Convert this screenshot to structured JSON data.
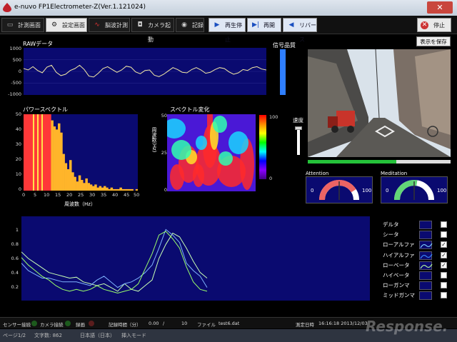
{
  "window": {
    "title": "e-nuvo FP1Electrometer-Z(Ver.1.121024)"
  },
  "toolbar": {
    "buttons": [
      {
        "label": "計測画面"
      },
      {
        "label": "設定画面"
      },
      {
        "label": "脳波計測"
      },
      {
        "label": "カメラ起動"
      },
      {
        "label": "記録"
      },
      {
        "label": "再生停止"
      },
      {
        "label": "再開"
      },
      {
        "label": "リバース"
      },
      {
        "label": "停止"
      }
    ]
  },
  "raw": {
    "label": "RAWデータ",
    "yticks": [
      "1000",
      "500",
      "0",
      "-500",
      "-1000"
    ]
  },
  "signal_quality": {
    "label": "信号品質",
    "level": 1.0
  },
  "save_button": {
    "label": "表示を保存"
  },
  "power_spectrum": {
    "label": "パワースペクトル",
    "yticks": [
      "50",
      "40",
      "30",
      "20",
      "10",
      "0"
    ],
    "xticks": [
      "0",
      "5",
      "10",
      "15",
      "20",
      "25",
      "30",
      "35",
      "40",
      "45",
      "50"
    ],
    "xlabel": "周波数（Hz）"
  },
  "spectrogram": {
    "label": "スペクトル変化",
    "ylabel": "周波数(Hz)",
    "yticks": [
      "50",
      "25",
      "0"
    ],
    "colorbar_ticks": [
      "100",
      "0"
    ]
  },
  "speed": {
    "label": "速度"
  },
  "camera": {
    "progress": 0.62
  },
  "attention": {
    "label": "Attention",
    "min": "0",
    "max": "100",
    "value": 0.82
  },
  "meditation": {
    "label": "Meditation",
    "min": "0",
    "max": "100",
    "value": 0.55
  },
  "trend": {
    "yticks": [
      "1",
      "0.8",
      "0.6",
      "0.4",
      "0.2"
    ]
  },
  "legend": [
    {
      "label": "デルタ",
      "checked": false,
      "color": "#0a0a70"
    },
    {
      "label": "シータ",
      "checked": false,
      "color": "#0a0a70"
    },
    {
      "label": "ローアルファ",
      "checked": true,
      "color": "#7fd1ff"
    },
    {
      "label": "ハイアルファ",
      "checked": true,
      "color": "#3a8cff"
    },
    {
      "label": "ローベータ",
      "checked": true,
      "color": "#b9ff9a"
    },
    {
      "label": "ハイベータ",
      "checked": false,
      "color": "#0a0a70"
    },
    {
      "label": "ローガンマ",
      "checked": false,
      "color": "#0a0a70"
    },
    {
      "label": "ミッドガンマ",
      "checked": false,
      "color": "#0a0a70"
    }
  ],
  "status": {
    "sensor": "センサー接続",
    "camera": "カメラ接続",
    "recording": "録画",
    "rec_time_label": "記録時間（分）",
    "rec_time_value": "0.00",
    "rec_time_sep": "/",
    "rec_time_total": "10",
    "file_label": "ファイル",
    "file_name": "test6.dat",
    "datetime_label": "測定日時",
    "datetime_value": "16:16:18  2013/12/03"
  },
  "taskbar": {
    "items": [
      "ページ1/2",
      "文字数: 862",
      "日本語（日本）",
      "挿入モード"
    ]
  },
  "watermark": "Response.",
  "chart_data": [
    {
      "type": "line",
      "title": "RAWデータ",
      "ylim": [
        -1000,
        1000
      ],
      "series": [
        {
          "values": [
            120,
            60,
            200,
            40,
            -60,
            180,
            260,
            -40,
            -180,
            -120,
            40,
            120,
            260,
            80,
            -200,
            -240,
            -80,
            120,
            200,
            80,
            -40,
            60,
            220,
            180,
            -20,
            -100,
            40,
            60,
            -160,
            -220,
            -120,
            20,
            160,
            80,
            -40,
            -60,
            80,
            160,
            60,
            -80,
            -40,
            80,
            160,
            120,
            -20,
            -120,
            -60,
            80,
            40,
            160,
            200,
            100,
            60
          ]
        }
      ]
    },
    {
      "type": "bar",
      "title": "パワースペクトル",
      "xlabel": "周波数（Hz）",
      "xlim": [
        0,
        50
      ],
      "ylim": [
        0,
        50
      ],
      "values": [
        50,
        50,
        50,
        50,
        50,
        50,
        50,
        50,
        50,
        50,
        50,
        50,
        46,
        42,
        40,
        44,
        38,
        24,
        18,
        14,
        20,
        12,
        9,
        6,
        10,
        7,
        5,
        8,
        5,
        4,
        3,
        4,
        2,
        3,
        2,
        3,
        2,
        1,
        2,
        1,
        1,
        1,
        2,
        1,
        1,
        1,
        1,
        1,
        0,
        1
      ]
    },
    {
      "type": "line",
      "ylim": [
        0.1,
        1
      ],
      "series": [
        {
          "values": [
            0.62,
            0.55,
            0.5,
            0.45,
            0.4,
            0.38,
            0.36,
            0.34,
            0.35,
            0.3,
            0.28,
            0.26,
            0.28,
            0.24,
            0.2,
            0.28,
            0.22,
            0.2,
            0.26,
            0.32,
            0.55,
            0.7,
            0.82,
            0.78,
            0.66,
            0.52,
            0.4,
            0.34
          ]
        },
        {
          "values": [
            0.5,
            0.42,
            0.38,
            0.34,
            0.34,
            0.32,
            0.3,
            0.3,
            0.3,
            0.28,
            0.26,
            0.32,
            0.36,
            0.3,
            0.24,
            0.28,
            0.3,
            0.34,
            0.4,
            0.48,
            0.66,
            0.86,
            0.8,
            0.72,
            0.5,
            0.42,
            0.36,
            0.24
          ]
        },
        {
          "values": [
            0.56,
            0.48,
            0.42,
            0.36,
            0.32,
            0.26,
            0.22,
            0.2,
            0.22,
            0.2,
            0.22,
            0.26,
            0.22,
            0.2,
            0.18,
            0.2,
            0.22,
            0.28,
            0.44,
            0.6,
            0.8,
            0.84,
            0.76,
            0.66,
            0.46,
            0.3,
            0.22,
            0.2
          ]
        }
      ]
    }
  ]
}
